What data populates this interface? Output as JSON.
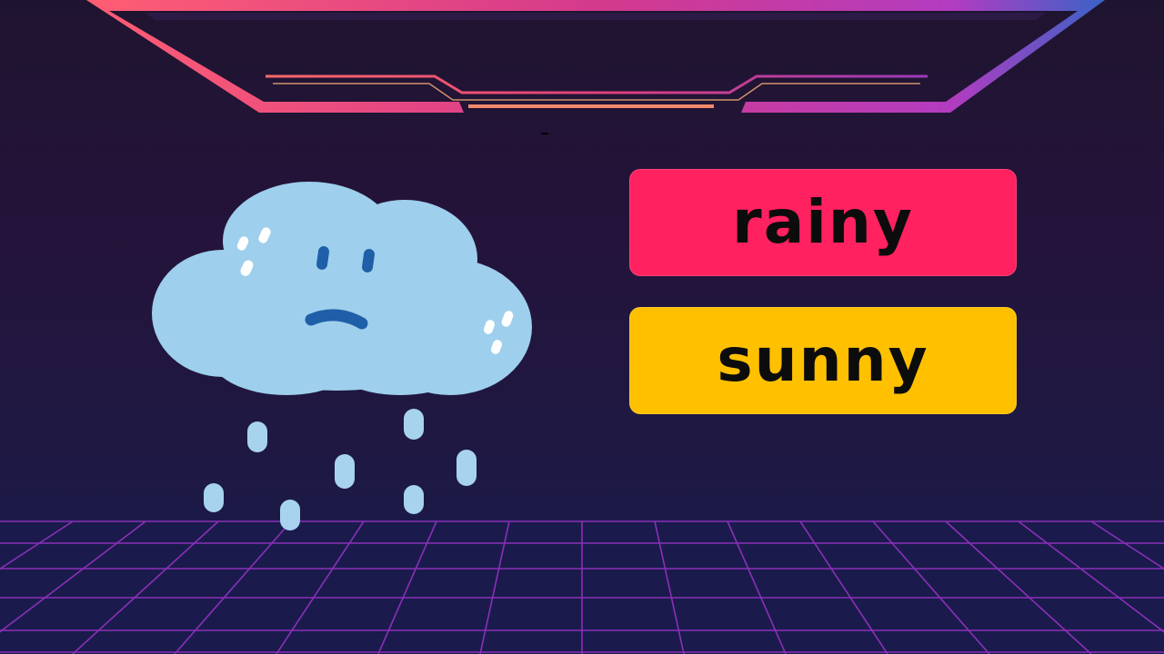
{
  "scene": {
    "picture_icon": "rain-cloud-sad-icon",
    "background_color": "#21153a",
    "grid_color": "#8a2fb8"
  },
  "choices": [
    {
      "label": "rainy",
      "color": "#ff2160"
    },
    {
      "label": "sunny",
      "color": "#ffc000"
    }
  ]
}
